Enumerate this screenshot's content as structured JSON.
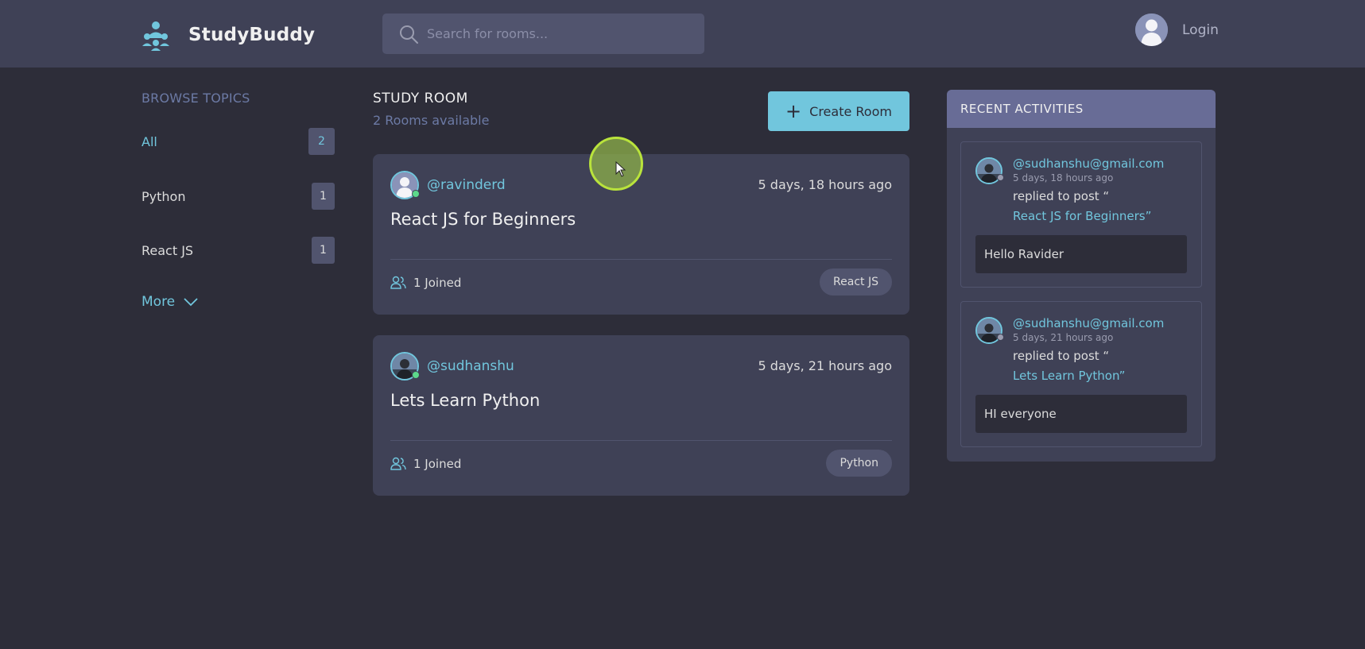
{
  "app": {
    "name": "StudyBuddy"
  },
  "header": {
    "search_placeholder": "Search for rooms...",
    "login_label": "Login"
  },
  "sidebar": {
    "title": "BROWSE TOPICS",
    "topics": [
      {
        "label": "All",
        "count": "2",
        "active": true
      },
      {
        "label": "Python",
        "count": "1",
        "active": false
      },
      {
        "label": "React JS",
        "count": "1",
        "active": false
      }
    ],
    "more_label": "More"
  },
  "main": {
    "title": "STUDY ROOM",
    "subtitle": "2 Rooms available",
    "create_label": "Create Room",
    "rooms": [
      {
        "host": "@ravinderd",
        "time": "5 days, 18 hours ago",
        "title": "React JS for Beginners",
        "joined": "1 Joined",
        "topic": "React JS"
      },
      {
        "host": "@sudhanshu",
        "time": "5 days, 21 hours ago",
        "title": "Lets Learn Python",
        "joined": "1 Joined",
        "topic": "Python"
      }
    ]
  },
  "activities": {
    "title": "RECENT ACTIVITIES",
    "items": [
      {
        "user": "@sudhanshu@gmail.com",
        "time": "5 days, 18 hours ago",
        "action": "replied to post “",
        "post": "React JS for Beginners”",
        "message": "Hello Ravider"
      },
      {
        "user": "@sudhanshu@gmail.com",
        "time": "5 days, 21 hours ago",
        "action": "replied to post “",
        "post": "Lets Learn Python”",
        "message": "HI everyone"
      }
    ]
  },
  "colors": {
    "background": "#2d2d39",
    "panel": "#3f4156",
    "accent": "#71c6dd",
    "activity_header": "#686c96"
  }
}
